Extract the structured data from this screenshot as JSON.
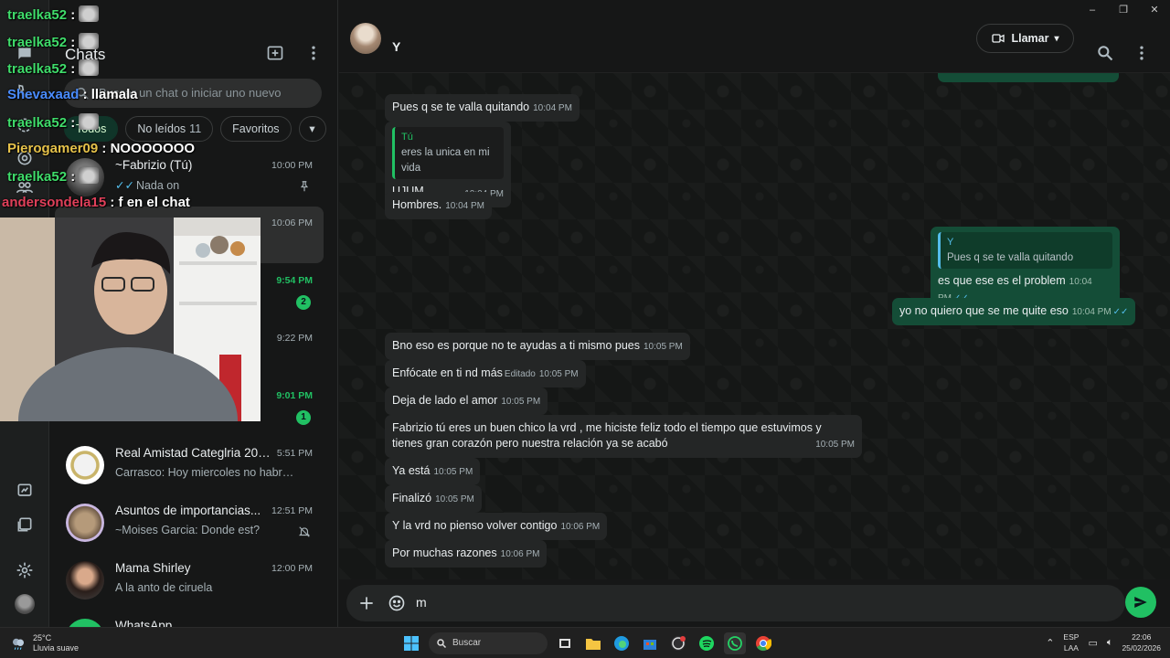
{
  "window": {
    "minimize": "‒",
    "maximize": "❐",
    "close": "✕"
  },
  "chat_list": {
    "title": "Chats",
    "search_placeholder": "Buscar un chat o iniciar uno nuevo",
    "filters": [
      {
        "label": "Todos",
        "active": true
      },
      {
        "label": "No leídos",
        "count": "11"
      },
      {
        "label": "Favoritos"
      }
    ],
    "chats": [
      {
        "name": "~Fabrizio (Tú)",
        "preview": "Nada on",
        "time": "10:00 PM",
        "pinned": true
      },
      {
        "name": "",
        "preview": "",
        "time": "10:06 PM",
        "selected": true
      },
      {
        "name": "",
        "preview": "",
        "time": "9:54 PM",
        "unread": "2"
      },
      {
        "name": "",
        "preview": "",
        "time": "9:22 PM"
      },
      {
        "name": "",
        "preview": "",
        "time": "9:01 PM",
        "unread": "1"
      },
      {
        "name": "Real Amistad Categlria 200...",
        "preview": "Carrasco: Hoy miercoles no habrá entr...",
        "time": "5:51 PM"
      },
      {
        "name": "Asuntos de importancias...",
        "preview": "~Moises Garcia: Donde est?",
        "time": "12:51 PM",
        "muted": true
      },
      {
        "name": "Mama Shirley",
        "preview": "A la anto de ciruela",
        "time": "12:00 PM"
      },
      {
        "name": "WhatsApp",
        "preview": "",
        "time": ""
      }
    ]
  },
  "conversation": {
    "contact_name": "Y",
    "call_label": "Llamar",
    "messages": [
      {
        "dir": "in",
        "text": "Pues q se te valla quitando",
        "time": "10:04 PM"
      },
      {
        "dir": "in",
        "quote_author": "Tú",
        "quote_text": "eres la unica en mi vida",
        "text": "UJUM",
        "time": "10:04 PM"
      },
      {
        "dir": "in",
        "text": "Hombres.",
        "time": "10:04 PM"
      },
      {
        "dir": "out",
        "quote_author": "Y",
        "quote_text": "Pues q se te valla quitando",
        "text": "es que ese es el problem",
        "time": "10:04 PM"
      },
      {
        "dir": "out",
        "text": "yo no quiero que se me quite eso",
        "time": "10:04 PM"
      },
      {
        "dir": "in",
        "text": "Bno eso es porque no te ayudas  a ti mismo pues",
        "time": "10:05 PM"
      },
      {
        "dir": "in",
        "text": "Enfócate  en ti  nd más",
        "edited": "Editado",
        "time": "10:05 PM"
      },
      {
        "dir": "in",
        "text": "Deja de lado el amor",
        "time": "10:05 PM"
      },
      {
        "dir": "in",
        "text": "Fabrizio tú eres un buen chico la vrd , me hiciste feliz todo el tiempo que estuvimos y tienes gran corazón pero nuestra relación ya se acabó",
        "time": "10:05 PM"
      },
      {
        "dir": "in",
        "text": "Ya está",
        "time": "10:05 PM"
      },
      {
        "dir": "in",
        "text": "Finalizó",
        "time": "10:05 PM"
      },
      {
        "dir": "in",
        "text": "Y la vrd no pienso volver contigo",
        "time": "10:06 PM"
      },
      {
        "dir": "in",
        "text": "Por muchas razones",
        "time": "10:06 PM"
      }
    ],
    "composer_value": "m"
  },
  "stream_chat": [
    {
      "user": "traelka52",
      "text": ":",
      "color": "#3fdc6a",
      "emote": true
    },
    {
      "user": "traelka52",
      "text": ":",
      "color": "#3fdc6a",
      "emote": true
    },
    {
      "user": "traelka52",
      "text": ":",
      "color": "#3fdc6a",
      "emote": true
    },
    {
      "user": "Shevaxaad",
      "text": ": llamala",
      "color": "#4a8cff",
      "emote": false
    },
    {
      "user": "traelka52",
      "text": ":",
      "color": "#3fdc6a",
      "emote": true
    },
    {
      "user": "Pierogamer09",
      "text": ": NOOOOOOO",
      "color": "#e6c24a",
      "emote": false
    },
    {
      "user": "traelka52",
      "text": ":",
      "color": "#3fdc6a",
      "emote": true
    },
    {
      "user": "andersondela15",
      "text": ": f en el chat",
      "color": "#e0405a",
      "emote": false
    }
  ],
  "taskbar": {
    "weather_temp": "25°C",
    "weather_desc": "Lluvia suave",
    "search_label": "Buscar",
    "lang_top": "ESP",
    "lang_bottom": "LAA",
    "time": "22:06",
    "date": "25/02/2026"
  },
  "colors": {
    "accent": "#21c063",
    "bubble_in": "#242626",
    "bubble_out": "#144d37",
    "tick_read": "#53bdeb"
  }
}
